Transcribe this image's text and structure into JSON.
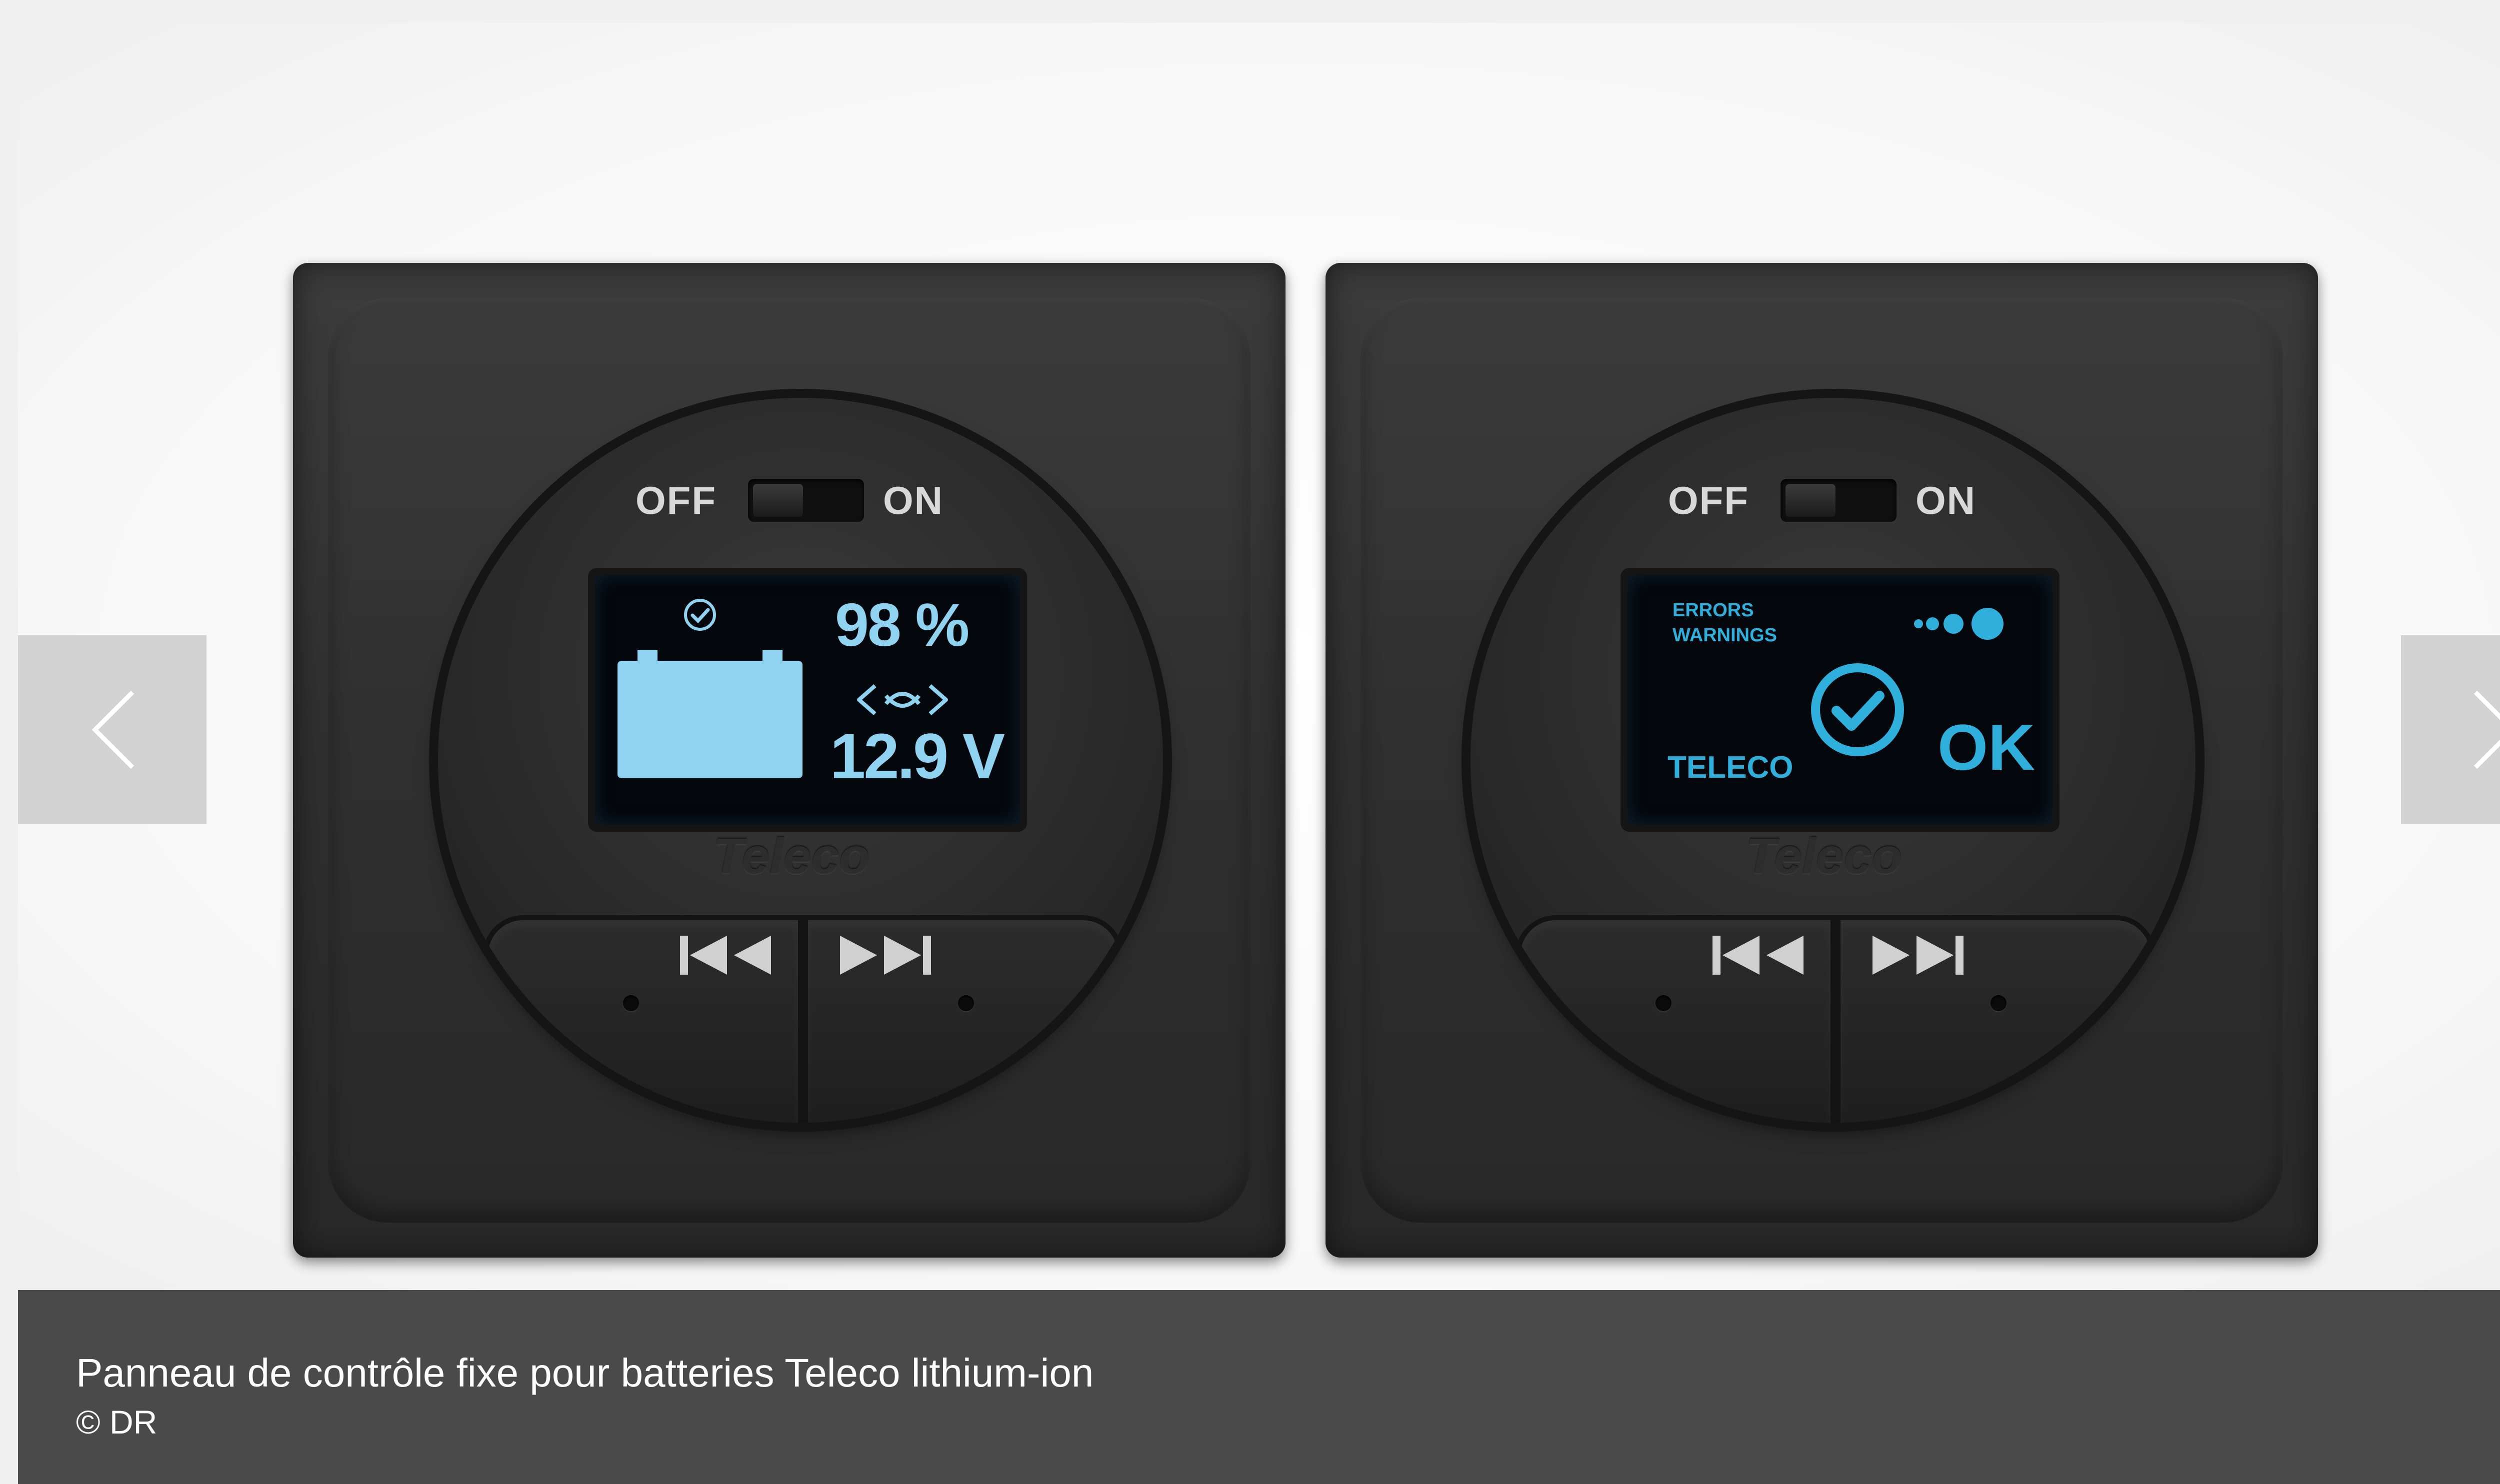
{
  "panels": [
    {
      "switch_off": "OFF",
      "switch_on": "ON",
      "screen": {
        "percent": "98 %",
        "voltage": "12.9 V"
      },
      "logo": "Teleco"
    },
    {
      "switch_off": "OFF",
      "switch_on": "ON",
      "screen": {
        "title": "ERRORS",
        "subtitle": "WARNINGS",
        "brand": "TELECO",
        "status": "OK"
      },
      "logo": "Teleco"
    }
  ],
  "caption": {
    "title": "Panneau de contrôle fixe pour batteries Teleco lithium-ion",
    "credit": "© DR"
  },
  "colors": {
    "screen_text": "#8fd3f0",
    "screen_accent": "#2fb0dc",
    "caption_bg": "#4a4a4a"
  },
  "icons": {
    "nav_prev": "chevron-left-icon",
    "nav_next": "chevron-right-icon",
    "prev": "skip-previous-icon",
    "next": "skip-next-icon",
    "battery": "battery-icon",
    "check": "check-circle-icon",
    "dots": "dots-icon",
    "flow": "flow-arrows-icon"
  }
}
